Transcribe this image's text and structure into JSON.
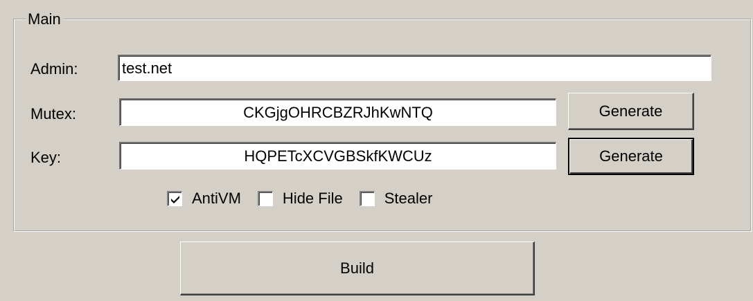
{
  "group": {
    "title": "Main"
  },
  "admin": {
    "label": "Admin:",
    "value": "test.net"
  },
  "mutex": {
    "label": "Mutex:",
    "value": "CKGjgOHRCBZRJhKwNTQ",
    "generate_label": "Generate"
  },
  "key": {
    "label": "Key:",
    "value": "HQPETcXCVGBSkfKWCUz",
    "generate_label": "Generate"
  },
  "options": [
    {
      "label": "AntiVM",
      "checked": true
    },
    {
      "label": "Hide File",
      "checked": false
    },
    {
      "label": "Stealer",
      "checked": false
    }
  ],
  "build": {
    "label": "Build"
  }
}
